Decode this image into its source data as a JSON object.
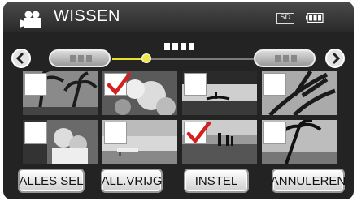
{
  "header": {
    "title": "WISSEN",
    "mode_icon": "video-camera-icon",
    "media_label": "SD",
    "battery_icon": "battery-icon"
  },
  "nav": {
    "prev_icon": "chevron-left-icon",
    "next_icon": "chevron-right-icon",
    "slider_position": 0.21
  },
  "thumbnails": [
    {
      "checked": false,
      "scene": "palm-trees"
    },
    {
      "checked": true,
      "scene": "flowers-closeup"
    },
    {
      "checked": false,
      "scene": "lake-boat"
    },
    {
      "checked": false,
      "scene": "tropical-plants"
    },
    {
      "checked": false,
      "scene": "couple-portrait"
    },
    {
      "checked": false,
      "scene": "landscape-lounge"
    },
    {
      "checked": true,
      "scene": "beach-silhouettes"
    },
    {
      "checked": false,
      "scene": "palm-beach"
    }
  ],
  "buttons": {
    "select_all": "ALLES SEL",
    "release_all": "ALL.VRIJG",
    "set": "INSTEL",
    "cancel": "ANNULEREN"
  },
  "colors": {
    "accent_check": "#d42020",
    "slider": "#e8e02a",
    "background": "#232323"
  }
}
